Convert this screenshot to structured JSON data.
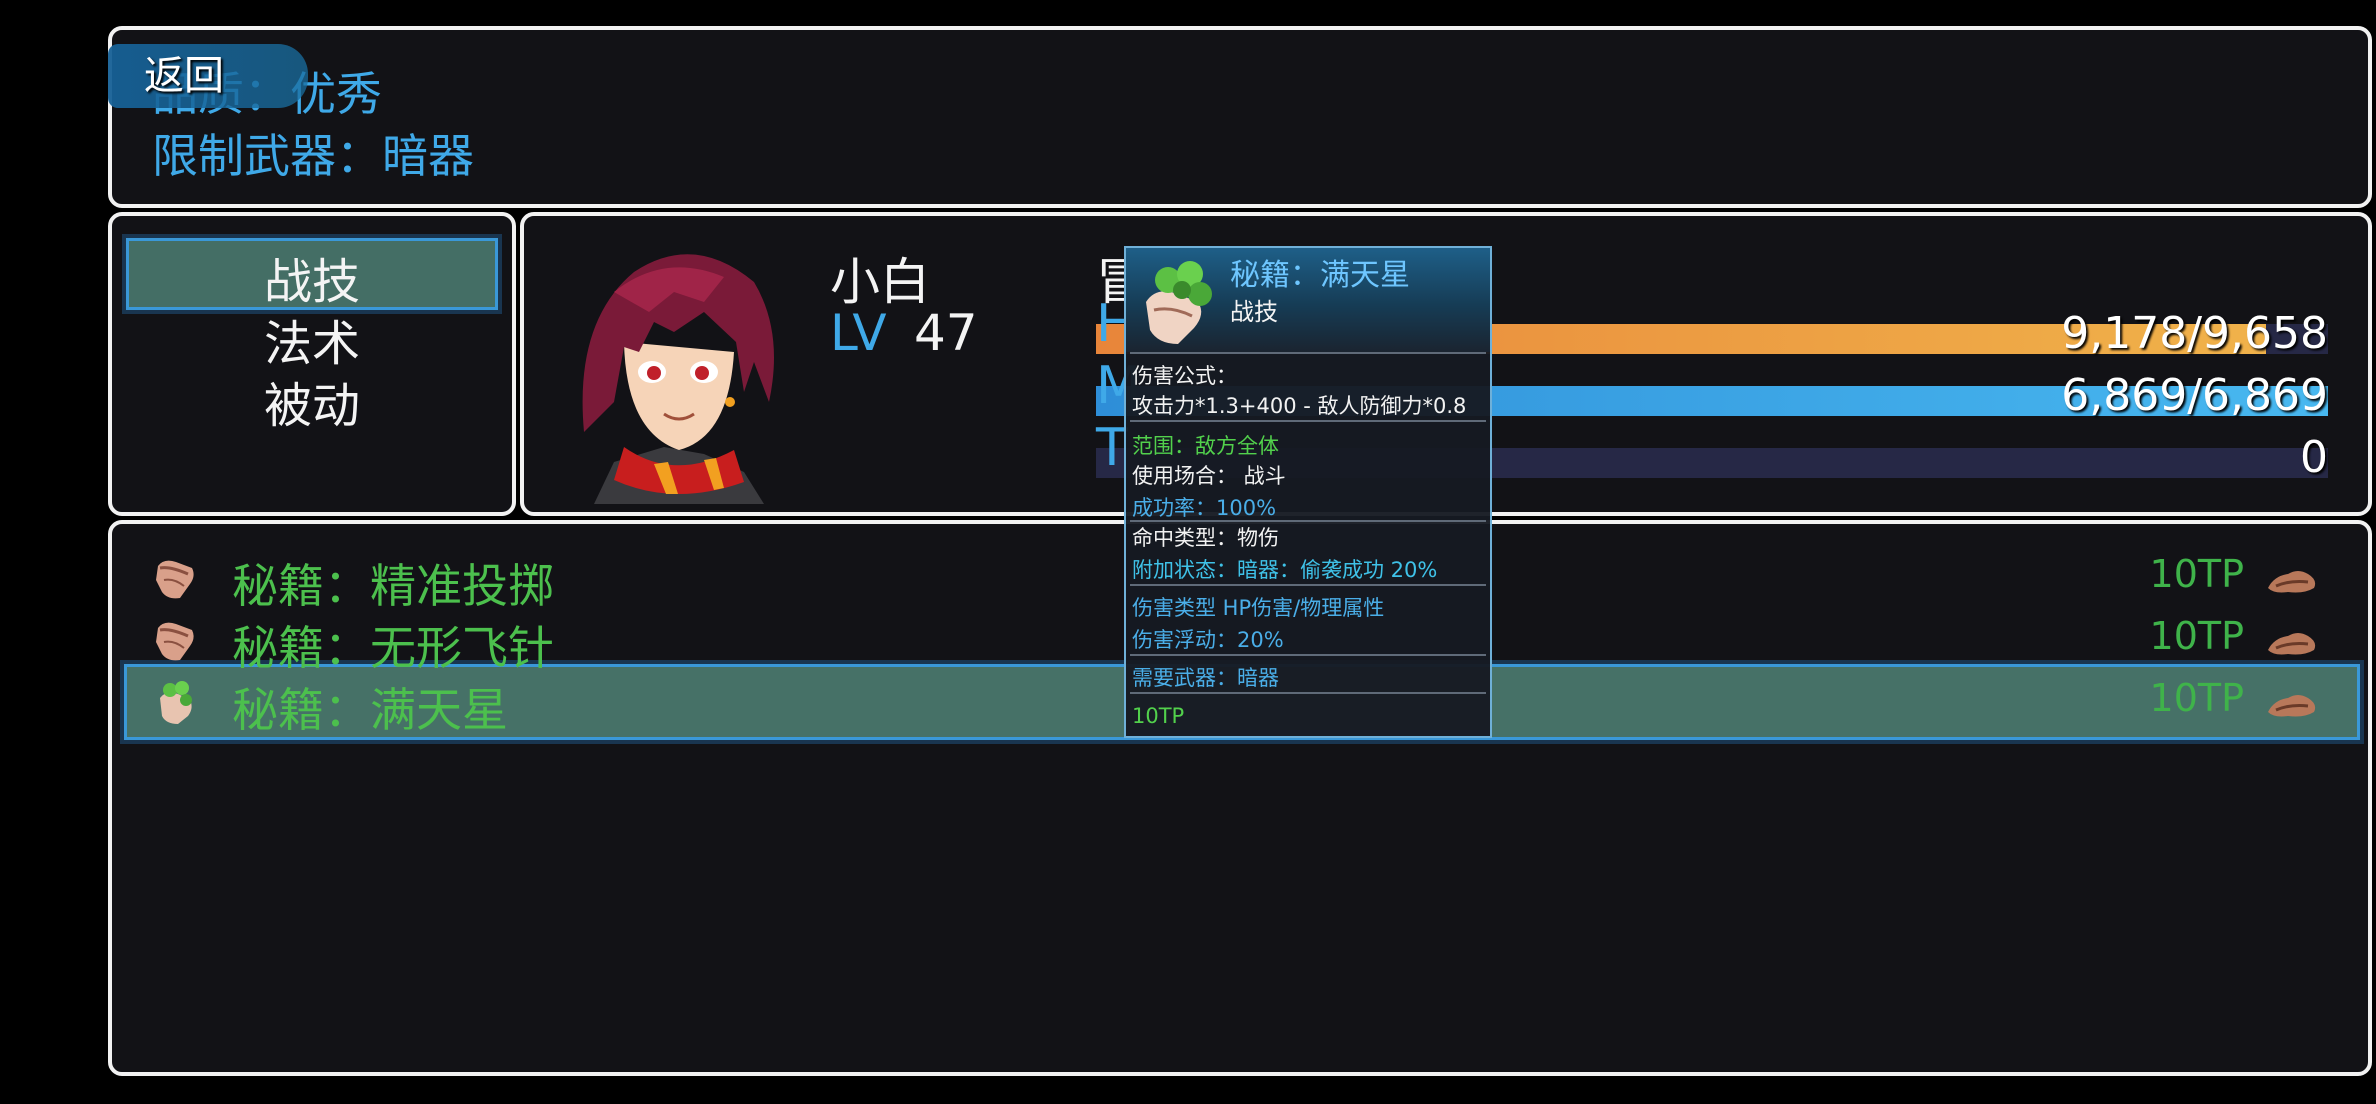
{
  "top_info": {
    "line1": "品质：优秀",
    "line2": "限制武器：暗器",
    "back_button": "返回"
  },
  "categories": {
    "items": [
      "战技",
      "法术",
      "被动"
    ],
    "selected": "战技"
  },
  "actor": {
    "name": "小白",
    "level_label": "LV",
    "level": "47",
    "class_glyph": "冒",
    "hp_label": "H",
    "hp": "9,178/9,658",
    "hp_fraction": 0.95,
    "mp_label": "M",
    "mp": "6,869/6,869",
    "mp_fraction": 1.0,
    "tp_label": "T",
    "tp": "0",
    "tp_fraction": 0.0
  },
  "skills": [
    {
      "name": "秘籍：精准投掷",
      "cost": "10TP",
      "icon": "scroll-icon"
    },
    {
      "name": "秘籍：无形飞针",
      "cost": "10TP",
      "icon": "scroll-icon"
    },
    {
      "name": "秘籍：满天星",
      "cost": "10TP",
      "icon": "clover-scroll-icon"
    }
  ],
  "selected_skill_index": 2,
  "tooltip": {
    "name": "秘籍：满天星",
    "type": "战技",
    "formula_label": "伤害公式：",
    "formula": "攻击力*1.3+400 - 敌人防御力*0.8",
    "scope": "范围：敌方全体",
    "occasion": "使用场合： 战斗",
    "success": "成功率：100%",
    "hit_type": "命中类型：物伤",
    "add_state": "附加状态：暗器：偷袭成功 20%",
    "damage_type": "伤害类型 HP伤害/物理属性",
    "variance": "伤害浮动：20%",
    "required_weapon": "需要武器：暗器",
    "cost": "10TP"
  },
  "colors": {
    "hp_gauge": "#f0a040",
    "mp_gauge": "#3aa8e8",
    "accent_blue": "#3fa9e8",
    "skill_green": "#4cc04d"
  }
}
